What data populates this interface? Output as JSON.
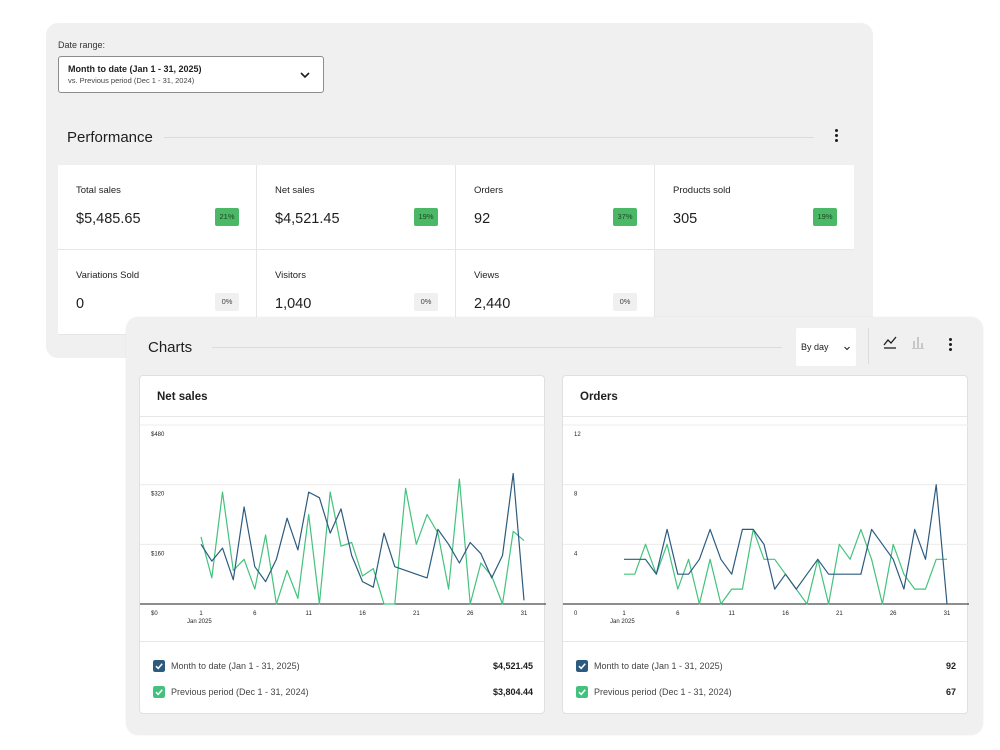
{
  "date_range": {
    "label": "Date range:",
    "main": "Month to date (Jan 1 - 31, 2025)",
    "compare": "vs. Previous period (Dec 1 - 31, 2024)"
  },
  "performance": {
    "title": "Performance",
    "tiles": [
      {
        "label": "Total sales",
        "value": "$5,485.65",
        "delta": "21%",
        "trend": "up"
      },
      {
        "label": "Net sales",
        "value": "$4,521.45",
        "delta": "19%",
        "trend": "up"
      },
      {
        "label": "Orders",
        "value": "92",
        "delta": "37%",
        "trend": "up"
      },
      {
        "label": "Products sold",
        "value": "305",
        "delta": "19%",
        "trend": "up"
      },
      {
        "label": "Variations Sold",
        "value": "0",
        "delta": "0%",
        "trend": "flat"
      },
      {
        "label": "Visitors",
        "value": "1,040",
        "delta": "0%",
        "trend": "flat"
      },
      {
        "label": "Views",
        "value": "2,440",
        "delta": "0%",
        "trend": "flat"
      }
    ]
  },
  "charts": {
    "title": "Charts",
    "interval": "By day",
    "icons": [
      "line-chart-icon",
      "bar-chart-icon",
      "more-vertical-icon"
    ],
    "colors": {
      "current": "#2d5b7f",
      "previous": "#43c27d"
    },
    "net_sales": {
      "title": "Net sales",
      "y_ticks": [
        "$480",
        "$320",
        "$160",
        "$0"
      ],
      "x_ticks": [
        "1",
        "6",
        "11",
        "16",
        "21",
        "26",
        "31"
      ],
      "x_sublabel": "Jan 2025",
      "legend": [
        {
          "label": "Month to date (Jan 1 - 31, 2025)",
          "value": "$4,521.45"
        },
        {
          "label": "Previous period (Dec 1 - 31, 2024)",
          "value": "$3,804.44"
        }
      ]
    },
    "orders": {
      "title": "Orders",
      "y_ticks": [
        "12",
        "8",
        "4",
        "0"
      ],
      "x_ticks": [
        "1",
        "6",
        "11",
        "16",
        "21",
        "26",
        "31"
      ],
      "x_sublabel": "Jan 2025",
      "legend": [
        {
          "label": "Month to date (Jan 1 - 31, 2025)",
          "value": "92"
        },
        {
          "label": "Previous period (Dec 1 - 31, 2024)",
          "value": "67"
        }
      ]
    }
  },
  "chart_data": [
    {
      "type": "line",
      "title": "Net sales",
      "xlabel": "",
      "ylabel": "",
      "x": [
        1,
        2,
        3,
        4,
        5,
        6,
        7,
        8,
        9,
        10,
        11,
        12,
        13,
        14,
        15,
        16,
        17,
        18,
        19,
        20,
        21,
        22,
        23,
        24,
        25,
        26,
        27,
        28,
        29,
        30,
        31
      ],
      "ylim": [
        0,
        480
      ],
      "series": [
        {
          "name": "Month to date (Jan 1 - 31, 2025)",
          "values": [
            160,
            115,
            150,
            65,
            260,
            100,
            60,
            120,
            230,
            145,
            300,
            285,
            190,
            255,
            130,
            60,
            45,
            190,
            100,
            90,
            80,
            70,
            200,
            160,
            110,
            165,
            135,
            70,
            130,
            350,
            10
          ]
        },
        {
          "name": "Previous period (Dec 1 - 31, 2024)",
          "values": [
            180,
            70,
            300,
            90,
            120,
            40,
            185,
            0,
            90,
            15,
            240,
            0,
            300,
            155,
            165,
            75,
            95,
            0,
            0,
            310,
            160,
            240,
            190,
            40,
            335,
            0,
            110,
            75,
            0,
            195,
            170
          ]
        }
      ]
    },
    {
      "type": "line",
      "title": "Orders",
      "xlabel": "",
      "ylabel": "",
      "x": [
        1,
        2,
        3,
        4,
        5,
        6,
        7,
        8,
        9,
        10,
        11,
        12,
        13,
        14,
        15,
        16,
        17,
        18,
        19,
        20,
        21,
        22,
        23,
        24,
        25,
        26,
        27,
        28,
        29,
        30,
        31
      ],
      "ylim": [
        0,
        12
      ],
      "series": [
        {
          "name": "Month to date (Jan 1 - 31, 2025)",
          "values": [
            3,
            3,
            3,
            2,
            5,
            2,
            2,
            3,
            5,
            3,
            2,
            5,
            5,
            4,
            1,
            2,
            1,
            2,
            3,
            2,
            2,
            2,
            2,
            5,
            4,
            3,
            1,
            5,
            3,
            8,
            0
          ]
        },
        {
          "name": "Previous period (Dec 1 - 31, 2024)",
          "values": [
            2,
            2,
            4,
            2,
            4,
            1,
            3,
            0,
            3,
            0,
            1,
            1,
            5,
            3,
            3,
            2,
            1,
            0,
            3,
            0,
            4,
            3,
            5,
            3,
            0,
            4,
            2,
            1,
            1,
            3,
            3
          ]
        }
      ]
    }
  ]
}
